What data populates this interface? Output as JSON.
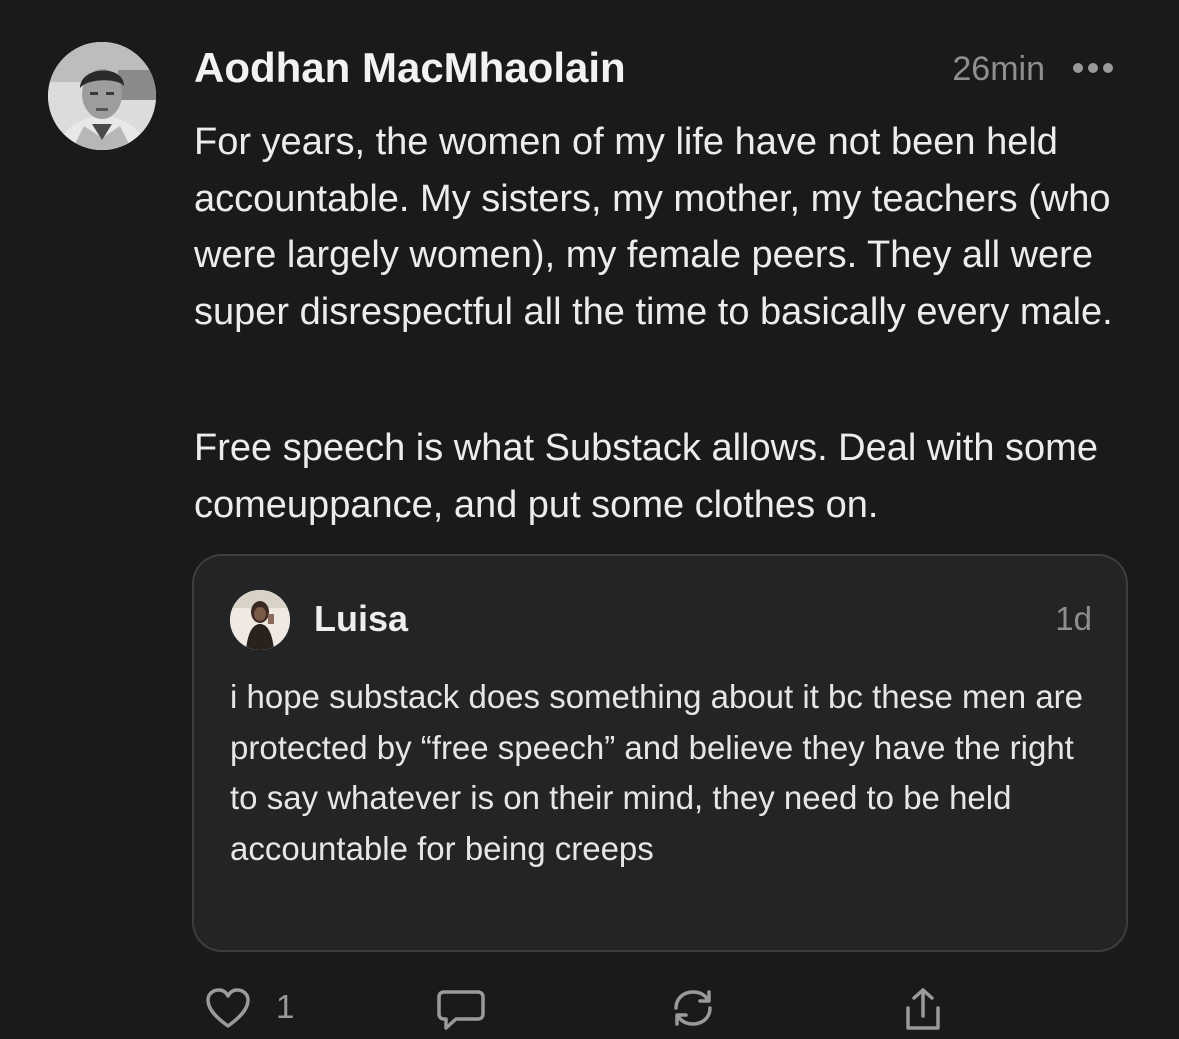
{
  "post": {
    "author": "Aodhan MacMhaolain",
    "time": "26min",
    "paragraphs": [
      "For years, the women of my life have not been held accountable. My sisters, my mother, my teachers (who were largely women), my female peers. They all were super disrespectful all the time to basically every male.",
      "Free speech is what Substack allows. Deal with some comeuppance, and put some clothes on."
    ],
    "avatar_icon": "user-photo",
    "more_icon": "more-horizontal-icon"
  },
  "quoted": {
    "author": "Luisa",
    "time": "1d",
    "text": "i hope substack does something about it bc these men are protected by “free speech” and believe they have the right to say whatever is on their mind, they need to be held accountable for being creeps",
    "avatar_icon": "user-photo"
  },
  "actions": {
    "like_count": "1",
    "icons": [
      "heart-icon",
      "comment-icon",
      "restack-icon",
      "share-icon"
    ]
  },
  "colors": {
    "background": "#1a1a1b",
    "card": "#222425",
    "card_border": "#3b3d3f",
    "text": "#ececec",
    "muted": "#8f8f8f"
  }
}
